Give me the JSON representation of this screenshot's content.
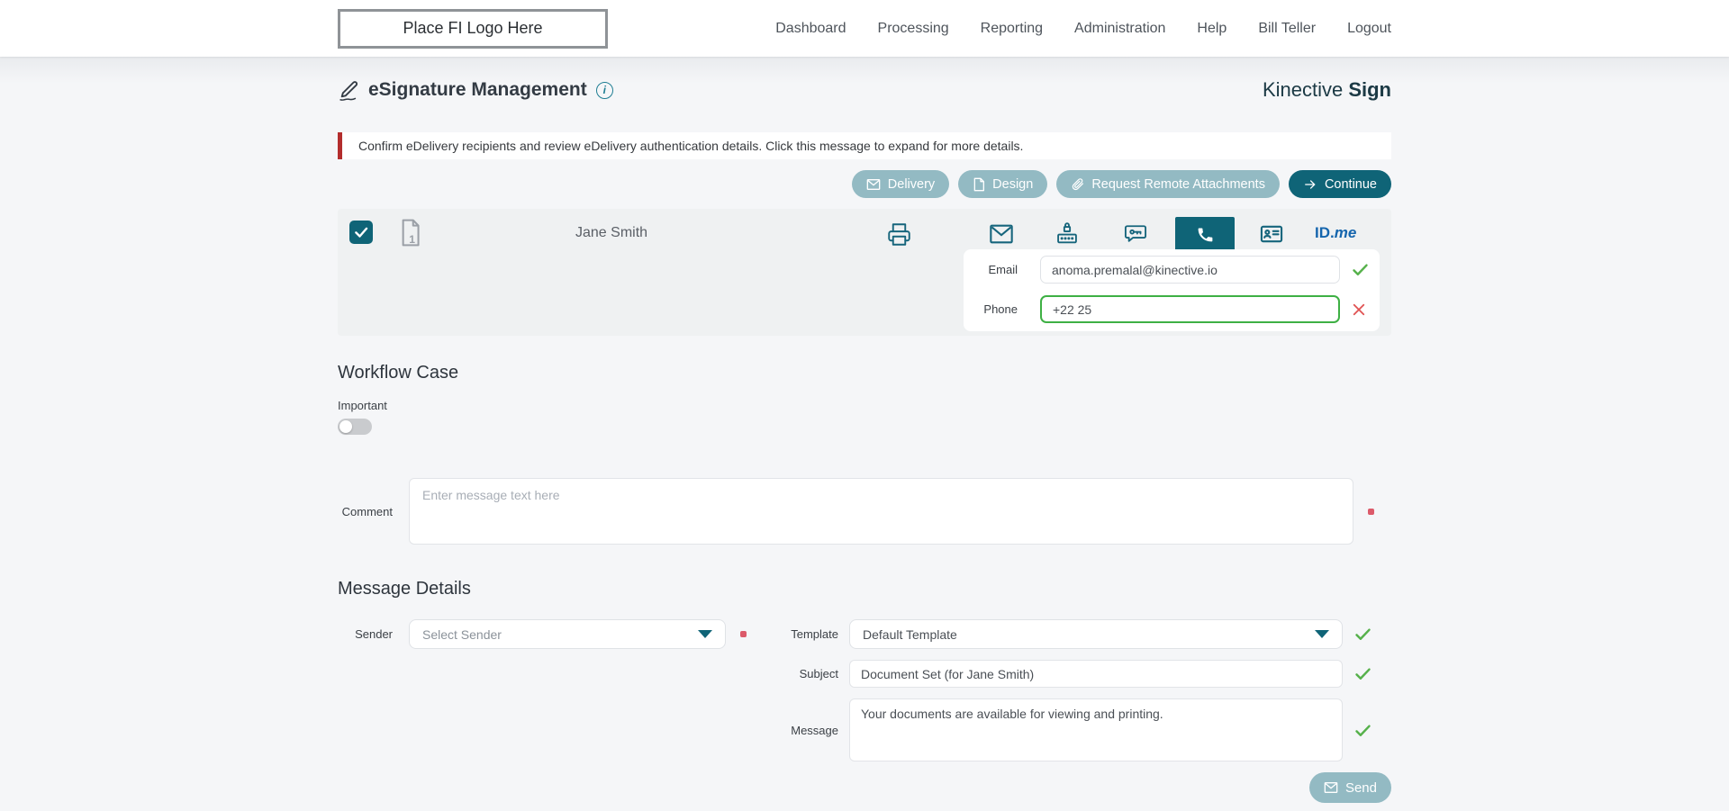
{
  "nav": {
    "logo_placeholder": "Place FI Logo Here",
    "items": [
      "Dashboard",
      "Processing",
      "Reporting",
      "Administration",
      "Help",
      "Bill Teller",
      "Logout"
    ]
  },
  "header": {
    "title": "eSignature Management",
    "info_glyph": "i",
    "brand_name": "Kinective ",
    "brand_suffix": "Sign"
  },
  "alert": {
    "message": "Confirm eDelivery recipients and review eDelivery authentication details. Click this message to expand for more details."
  },
  "toolbar": {
    "delivery": "Delivery",
    "design": "Design",
    "request_remote_attachments": "Request Remote Attachments",
    "continue": "Continue"
  },
  "recipient": {
    "name": "Jane Smith",
    "doc_count": "1",
    "idme_bold": "ID.",
    "idme_italic": "me",
    "email": {
      "label": "Email",
      "value": "anoma.premalal@kinective.io"
    },
    "phone": {
      "label": "Phone",
      "value": "+22 25"
    }
  },
  "workflow_case": {
    "heading": "Workflow Case",
    "important_label": "Important",
    "comment_label": "Comment",
    "comment_placeholder": "Enter message text here"
  },
  "message_details": {
    "heading": "Message Details",
    "sender_label": "Sender",
    "sender_placeholder": "Select Sender",
    "template_label": "Template",
    "template_value": "Default Template",
    "subject_label": "Subject",
    "subject_value": "Document Set (for Jane Smith)",
    "message_label": "Message",
    "message_value": "Your documents are available for viewing and printing.",
    "send_label": "Send"
  },
  "colors": {
    "teal_dark": "#0f6477",
    "teal_light": "#93bac3",
    "icon_teal": "#16657c",
    "green": "#56b14b",
    "red": "#e05252",
    "alert_red": "#b32d2d",
    "idme_blue": "#1565ad"
  }
}
